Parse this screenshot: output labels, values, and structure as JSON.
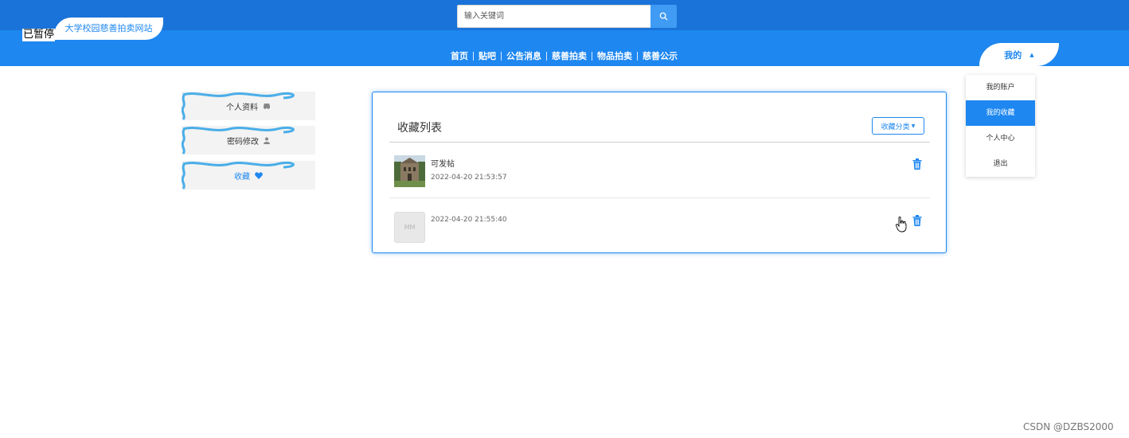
{
  "header": {
    "paused_label": "已暂停",
    "site_name": "大学校园慈善拍卖网站",
    "search_placeholder": "输入关键词"
  },
  "nav": {
    "links": [
      "首页",
      "贴吧",
      "公告消息",
      "慈善拍卖",
      "物品拍卖",
      "慈善公示"
    ]
  },
  "user_menu": {
    "label": "我的",
    "items": [
      {
        "label": "我的账户",
        "active": false
      },
      {
        "label": "我的收藏",
        "active": true
      },
      {
        "label": "个人中心",
        "active": false
      },
      {
        "label": "退出",
        "active": false
      }
    ]
  },
  "sidebar": {
    "items": [
      {
        "label": "个人资料",
        "icon": "car-icon",
        "active": false
      },
      {
        "label": "密码修改",
        "icon": "user-icon",
        "active": false
      },
      {
        "label": "收藏",
        "icon": "heart-icon",
        "active": true
      }
    ]
  },
  "favorites": {
    "title": "收藏列表",
    "category_button": "收藏分类",
    "items": [
      {
        "title": "可发帖",
        "time": "2022-04-20 21:53:57",
        "thumb": "building-photo"
      },
      {
        "title": "",
        "time": "2022-04-20 21:55:40",
        "thumb_text": "MM"
      }
    ]
  },
  "watermark": "CSDN @DZBS2000",
  "colors": {
    "topbar": "#1a73d9",
    "navbar": "#1e87f0",
    "accent": "#1e87f0",
    "wave": "#4aaee8"
  }
}
